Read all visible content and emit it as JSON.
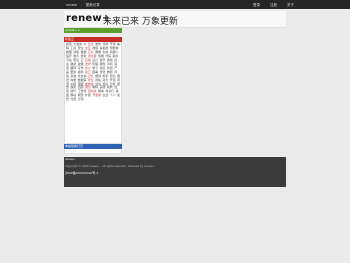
{
  "topbar": {
    "left_links": [
      "renew",
      "更新记录"
    ],
    "right_links": [
      "登录",
      "注册",
      "关于"
    ]
  },
  "header": {
    "logo": "renew+",
    "tagline": "未来已来 万象更新"
  },
  "sidebar": {
    "green_panel_title": "renew+ +",
    "red_panel_title": "标签云",
    "tags": [
      "模型",
      "大语言",
      "AI",
      "论文",
      "发布",
      "评测",
      "开源",
      "编程",
      "工具",
      "安全",
      "交互",
      "视频",
      "多模态",
      "智能体",
      "推理",
      "训练",
      "数据",
      "芯片",
      "图像",
      "生成",
      "机器人",
      "医疗",
      "教育",
      "搜索",
      "浏览器",
      "终端",
      "代码",
      "助手",
      "平台",
      "研究",
      "云",
      "应用",
      "设计",
      "音乐",
      "游戏",
      "创业",
      "融资",
      "政策",
      "法律",
      "伦理",
      "硬件",
      "手机",
      "语音",
      "翻译",
      "写作",
      "办公",
      "学习",
      "社区",
      "新闻",
      "产品",
      "更新",
      "插件",
      "接口",
      "部署",
      "优化",
      "微调",
      "评估",
      "基准",
      "长文本",
      "记忆",
      "规划",
      "检索",
      "知识",
      "图谱",
      "向量",
      "数据库",
      "安全",
      "隐私",
      "对齐",
      "开源",
      "闭源",
      "价格",
      "限额",
      "发布会",
      "访谈",
      "观点",
      "分析",
      "报告",
      "趋势",
      "回顾",
      "展望",
      "教程",
      "实践",
      "案例",
      "经验",
      "技巧",
      "工作流",
      "自动化",
      "脚本",
      "命令行",
      "桌面",
      "移动",
      "网页",
      "扩展",
      "开发者",
      "企业",
      "个人",
      "免费",
      "付费",
      "订阅"
    ],
    "blue_panel_title": "本站赞助打赏"
  },
  "footer": {
    "line1": "renew+",
    "line2": "Copyright © 2024 renew+ · All rights reserved · Powered by renew+",
    "line3": "沪ICP备XXXXXXXX号-1"
  }
}
